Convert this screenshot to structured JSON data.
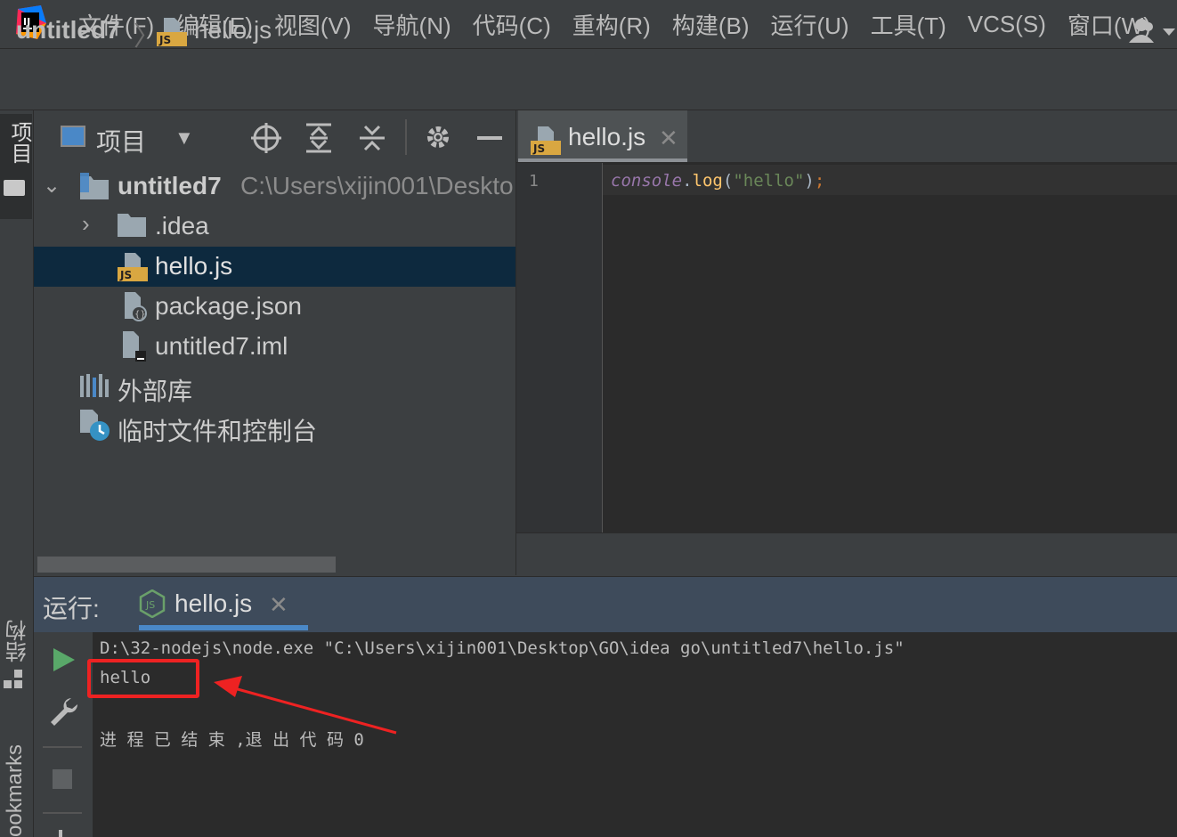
{
  "menu": {
    "items": [
      "文件(F)",
      "编辑(E)",
      "视图(V)",
      "导航(N)",
      "代码(C)",
      "重构(R)",
      "构建(B)",
      "运行(U)",
      "工具(T)",
      "VCS(S)",
      "窗口(W)"
    ]
  },
  "breadcrumb": {
    "project": "untitled7",
    "file": "hello.js"
  },
  "left_strip": {
    "project": "项目",
    "structure": "结构",
    "bookmarks": "ookmarks"
  },
  "project_panel": {
    "title": "项目",
    "tree": {
      "root_name": "untitled7",
      "root_path": "C:\\Users\\xijin001\\Deskto",
      "idea": ".idea",
      "hello": "hello.js",
      "package": "package.json",
      "iml": "untitled7.iml",
      "external": "外部库",
      "scratches": "临时文件和控制台"
    }
  },
  "editor": {
    "tab_label": "hello.js",
    "line_number": "1",
    "code": {
      "obj": "console",
      "dot": ".",
      "fn": "log",
      "lparen": "(",
      "str": "\"hello\"",
      "rparen": ")",
      "semi": ";"
    }
  },
  "run": {
    "label": "运行:",
    "tab_label": "hello.js",
    "command": "D:\\32-nodejs\\node.exe \"C:\\Users\\xijin001\\Desktop\\GO\\idea go\\untitled7\\hello.js\"",
    "output": "hello",
    "exit_message": "进 程 已 结 束 ,退 出 代 码 0"
  },
  "colors": {
    "background": "#3c3f41",
    "editor_bg": "#2b2b2b",
    "selection": "#0d293e",
    "annotation_red": "#ee2222",
    "run_green": "#59a869"
  }
}
